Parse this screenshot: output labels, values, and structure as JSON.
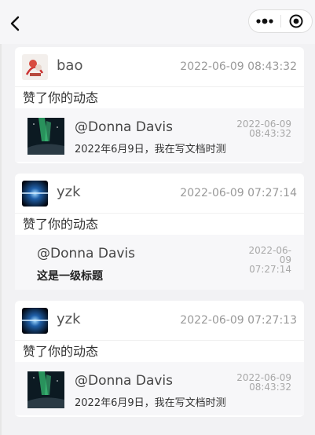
{
  "nav": {
    "back_icon": "back-chevron-icon",
    "more_icon": "more-dots-icon",
    "close_icon": "target-close-icon"
  },
  "notifications": [
    {
      "user": "bao",
      "time": "2022-06-09 08:43:32",
      "action": "赞了你的动态",
      "quote": {
        "mention": "@Donna Davis",
        "text": "2022年6月9日，我在写文档时测",
        "time_line1": "2022-06-09",
        "time_line2": "08:43:32"
      }
    },
    {
      "user": "yzk",
      "time": "2022-06-09 07:27:14",
      "action": "赞了你的动态",
      "quote": {
        "mention": "@Donna Davis",
        "text": "这是一级标题",
        "time_line1": "2022-06-",
        "time_line2": "09",
        "time_line3": "07:27:14"
      }
    },
    {
      "user": "yzk",
      "time": "2022-06-09 07:27:13",
      "action": "赞了你的动态",
      "quote": {
        "mention": "@Donna Davis",
        "text": "2022年6月9日，我在写文档时测",
        "time_line1": "2022-06-09",
        "time_line2": "08:43:32"
      }
    }
  ]
}
